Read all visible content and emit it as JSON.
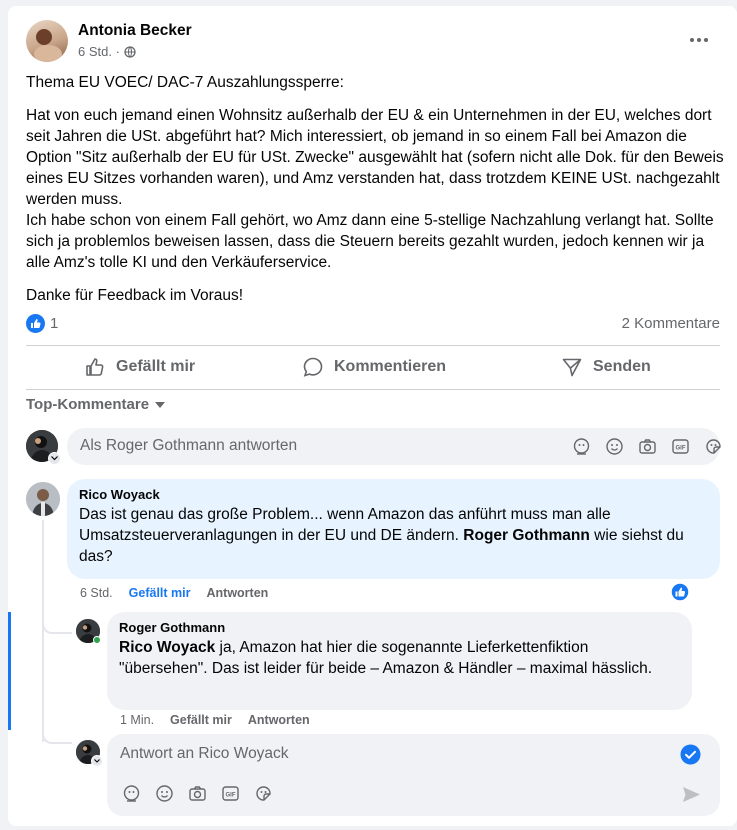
{
  "post": {
    "author": "Antonia Becker",
    "time": "6 Std. ·",
    "paragraphs": [
      "Thema EU VOEC/ DAC-7 Auszahlungssperre:",
      "Hat von euch jemand einen Wohnsitz außerhalb der EU & ein Unternehmen in der EU, welches dort seit Jahren die USt. abgeführt hat? Mich interessiert, ob jemand in so einem Fall bei Amazon die Option \"Sitz außerhalb der EU für USt. Zwecke\" ausgewählt hat (sofern nicht alle Dok. für den Beweis eines EU Sitzes vorhanden waren), und Amz verstanden hat, dass trotzdem KEINE USt. nachgezahlt werden muss.\nIch habe schon von einem Fall gehört, wo Amz dann eine 5-stellige Nachzahlung verlangt hat. Sollte sich ja problemlos beweisen lassen, dass die Steuern bereits gezahlt wurden, jedoch kennen wir ja alle Amz's tolle KI und den Verkäuferservice.",
      "Danke für Feedback im Voraus!"
    ],
    "like_count": "1",
    "comments_count": "2 Kommentare"
  },
  "actions": {
    "like": "Gefällt mir",
    "comment": "Kommentieren",
    "send": "Senden"
  },
  "sort_label": "Top-Kommentare",
  "reply_as_placeholder": "Als Roger Gothmann antworten",
  "comments": [
    {
      "author": "Rico Woyack",
      "text_before": "Das ist genau das große Problem... wenn Amazon das anführt muss man alle Umsatzsteuerveranlagungen in der EU und DE ändern. ",
      "mention": "Roger Gothmann",
      "text_after": " wie siehst du das?",
      "time": "6 Std.",
      "like": "Gefällt mir",
      "reply": "Antworten"
    }
  ],
  "reply": {
    "author": "Roger Gothmann",
    "mention": "Rico Woyack",
    "text": " ja, Amazon hat hier die sogenannte Lieferkettenfiktion \"übersehen\". Das ist leider für beide – Amazon & Händler – maximal hässlich.",
    "time": "1 Min.",
    "like": "Gefällt mir",
    "reply": "Antworten"
  },
  "reply_input_placeholder": "Antwort an Rico Woyack",
  "colors": {
    "accent": "#1877f2",
    "bubble": "#f0f2f5",
    "bubble_highlight": "#e7f3ff",
    "thread_line": "#1877f2"
  }
}
